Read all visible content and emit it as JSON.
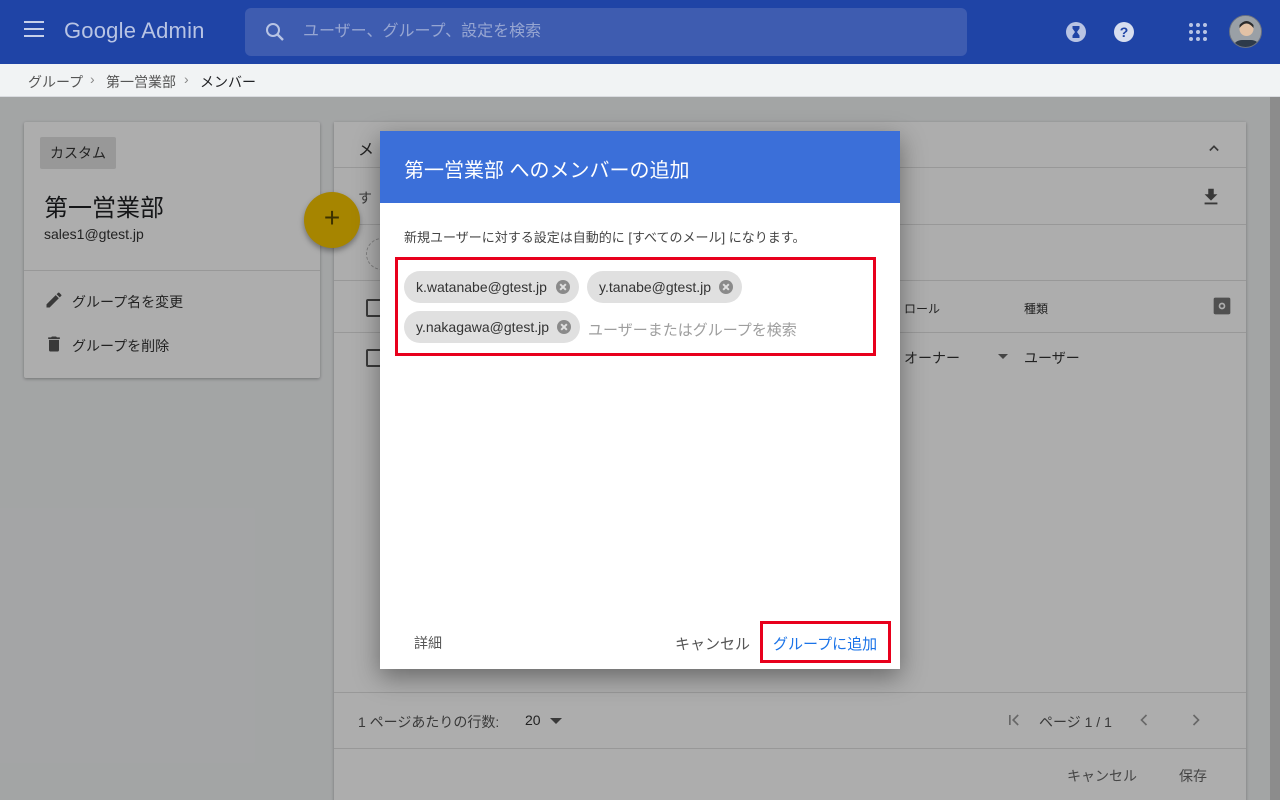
{
  "app": {
    "brand": "Google Admin"
  },
  "search": {
    "placeholder": "ユーザー、グループ、設定を検索"
  },
  "breadcrumb": [
    "グループ",
    "第一営業部",
    "メンバー"
  ],
  "group_card": {
    "badge": "カスタム",
    "title": "第一営業部",
    "email": "sales1@gtest.jp",
    "actions": [
      {
        "icon": "pencil-icon",
        "label": "グループ名を変更"
      },
      {
        "icon": "trash-icon",
        "label": "グループを削除"
      }
    ]
  },
  "fab": {
    "icon": "plus-icon",
    "label": "+"
  },
  "members_panel": {
    "title_partial": "メ",
    "filter_partial": "す",
    "columns": [
      "ロール",
      "種類"
    ],
    "row": {
      "role": "オーナー",
      "type": "ユーザー"
    },
    "rows_per_page_label": "1 ページあたりの行数:",
    "rows_per_page_value": "20",
    "page_label": "ページ 1 / 1",
    "cancel_label": "キャンセル",
    "save_label": "保存"
  },
  "dialog": {
    "title": "第一営業部 へのメンバーの追加",
    "description": "新規ユーザーに対する設定は自動的に [すべてのメール] になります。",
    "chips": [
      "k.watanabe@gtest.jp",
      "y.tanabe@gtest.jp",
      "y.nakagawa@gtest.jp"
    ],
    "input_placeholder": "ユーザーまたはグループを検索",
    "details_label": "詳細",
    "cancel_label": "キャンセル",
    "add_label": "グループに追加"
  },
  "colors": {
    "topbar": "#1f44a6",
    "dialog_header": "#3b6fd9",
    "highlight": "#e8001c",
    "fab": "#f5c400",
    "link": "#1a73e8"
  }
}
